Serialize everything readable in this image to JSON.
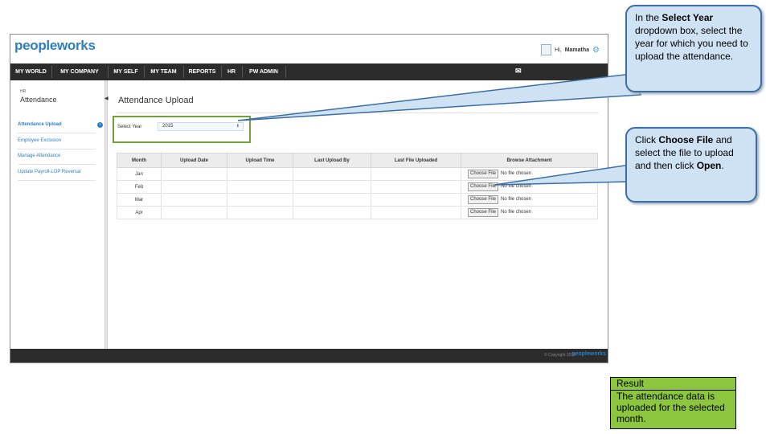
{
  "app": {
    "logo_part1": "peopleworks",
    "logo_part2": ""
  },
  "header": {
    "greeting": "Hi,",
    "user_name": "Mamatha"
  },
  "nav": [
    "MY WORLD",
    "MY COMPANY",
    "MY SELF",
    "MY TEAM",
    "REPORTS",
    "HR",
    "PW ADMIN"
  ],
  "sidebar": {
    "module": "HR",
    "title": "Attendance",
    "items": [
      {
        "label": "Attendance Upload",
        "active": true
      },
      {
        "label": "Employee Exclusion"
      },
      {
        "label": "Manage Attendance"
      },
      {
        "label": "Update Payroll-LOP Reversal"
      }
    ]
  },
  "main": {
    "title": "Attendance Upload",
    "year_label": "Select Year",
    "year_value": "2015",
    "table": {
      "headers": [
        "Month",
        "Upload Date",
        "Upload Time",
        "Last Upload By",
        "Last File Uploaded",
        "Browse Attachment"
      ],
      "rows": [
        {
          "month": "Jan",
          "button": "Choose File",
          "status": "No file chosen"
        },
        {
          "month": "Feb",
          "button": "Choose File",
          "status": "No file chosen"
        },
        {
          "month": "Mar",
          "button": "Choose File",
          "status": "No file chosen"
        },
        {
          "month": "Apr",
          "button": "Choose File",
          "status": "No file chosen"
        }
      ]
    }
  },
  "footer": {
    "copyright": "© Copyright 2015",
    "logo": "peopleworks"
  },
  "callouts": {
    "year": {
      "pre": "In the ",
      "bold": "Select Year",
      "post": " dropdown box, select the year for which you need to upload the attendance."
    },
    "file": {
      "pre": "Click ",
      "bold": "Choose File",
      "mid": " and select the file to upload and then click ",
      "bold2": "Open",
      "post": "."
    }
  },
  "result": {
    "heading": "Result",
    "body": "The attendance data is uploaded for the selected month."
  },
  "colors": {
    "nav_bg": "#2c2c2c",
    "link": "#2d7fc1",
    "accent_green": "#8cc63f",
    "callout_bg": "#cfe2f3",
    "callout_border": "#3a6ea5",
    "highlight_box": "#6fa23a"
  }
}
